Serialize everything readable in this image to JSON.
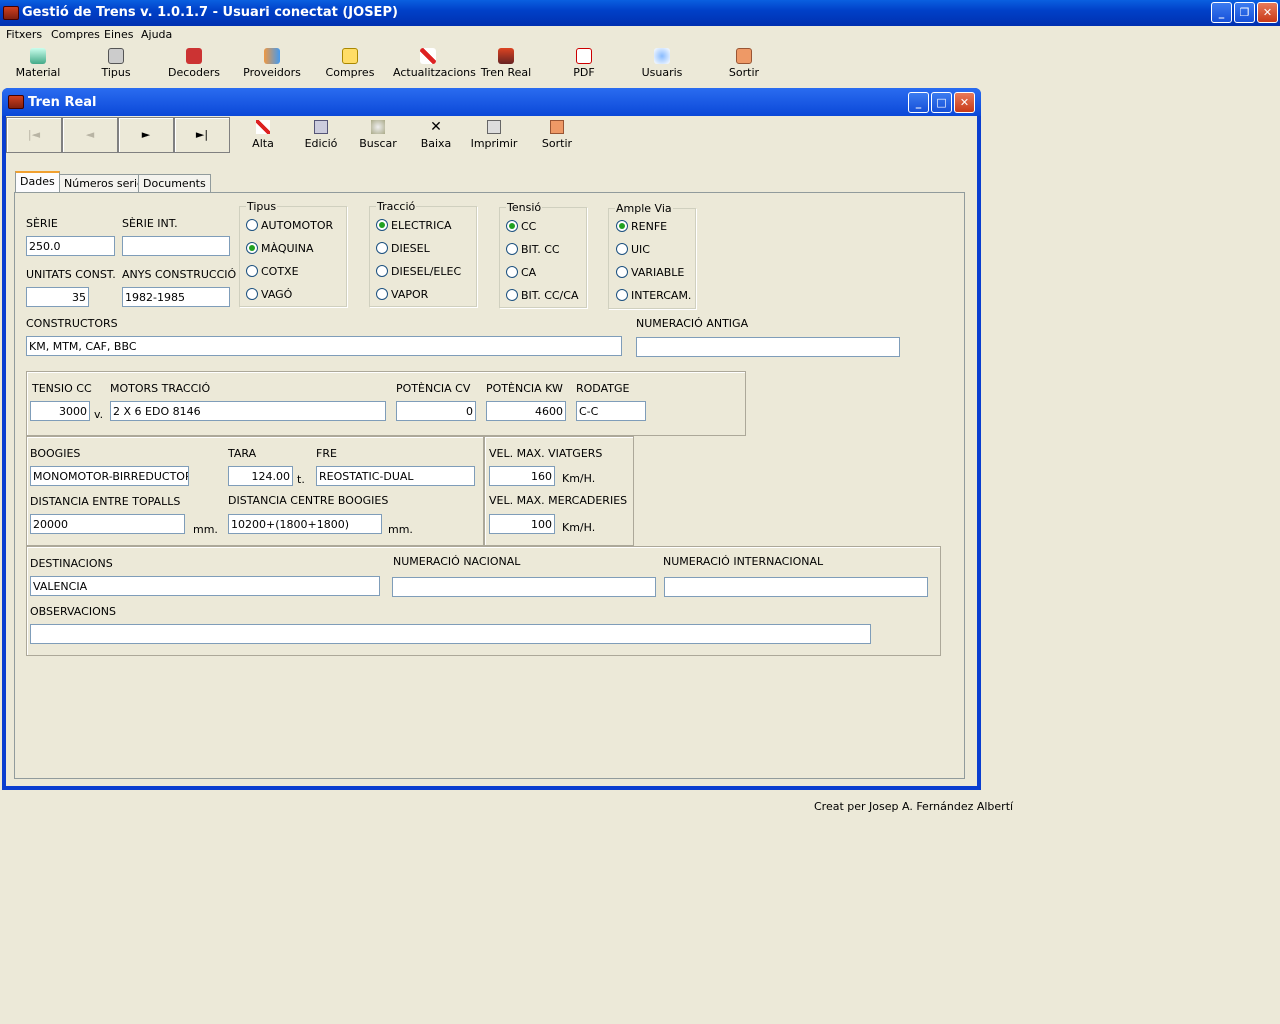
{
  "window": {
    "title": "Gestió de Trens v. 1.0.1.7 - Usuari conectat (JOSEP)"
  },
  "menu": [
    "Fitxers",
    "Compres",
    "Eines",
    "Ajuda"
  ],
  "toolbar": [
    {
      "label": "Material",
      "icon": "material-icon"
    },
    {
      "label": "Tipus",
      "icon": "train-icon"
    },
    {
      "label": "Decoders",
      "icon": "decoder-icon"
    },
    {
      "label": "Proveidors",
      "icon": "people-icon"
    },
    {
      "label": "Compres",
      "icon": "documents-icon"
    },
    {
      "label": "Actualitzacions",
      "icon": "pencil-icon"
    },
    {
      "label": "Tren Real",
      "icon": "locomotive-icon"
    },
    {
      "label": "PDF",
      "icon": "pdf-icon"
    },
    {
      "label": "Usuaris",
      "icon": "users-icon"
    },
    {
      "label": "Sortir",
      "icon": "exit-icon"
    }
  ],
  "child": {
    "title": "Tren Real",
    "nav": [
      "|◄",
      "◄",
      "►",
      "►|"
    ],
    "actions": [
      {
        "label": "Alta",
        "icon": "pencil-icon"
      },
      {
        "label": "Edició",
        "icon": "edit-icon"
      },
      {
        "label": "Buscar",
        "icon": "search-icon"
      },
      {
        "label": "Baixa",
        "icon": "delete-icon"
      },
      {
        "label": "Imprimir",
        "icon": "printer-icon"
      },
      {
        "label": "Sortir",
        "icon": "exit-icon"
      }
    ],
    "tabs": [
      "Dades",
      "Números serie",
      "Documents"
    ]
  },
  "form": {
    "serie_label": "SÈRIE",
    "serie": "250.0",
    "serie_int_label": "SÈRIE INT.",
    "serie_int": "",
    "unitats_label": "UNITATS CONST.",
    "unitats": "35",
    "anys_label": "ANYS CONSTRUCCIÓ",
    "anys": "1982-1985",
    "tipus": {
      "title": "Tipus",
      "options": [
        "AUTOMOTOR",
        "MÀQUINA",
        "COTXE",
        "VAGÓ"
      ],
      "selected": 1
    },
    "traccio": {
      "title": "Tracció",
      "options": [
        "ELECTRICA",
        "DIESEL",
        "DIESEL/ELEC",
        "VAPOR"
      ],
      "selected": 0
    },
    "tensio": {
      "title": "Tensió",
      "options": [
        "CC",
        "BIT. CC",
        "CA",
        "BIT. CC/CA"
      ],
      "selected": 0
    },
    "ample": {
      "title": "Ample Via",
      "options": [
        "RENFE",
        "UIC",
        "VARIABLE",
        "INTERCAM."
      ],
      "selected": 0
    },
    "constructors_label": "CONSTRUCTORS",
    "constructors": "KM, MTM, CAF, BBC",
    "num_antiga_label": "NUMERACIÓ ANTIGA",
    "num_antiga": "",
    "tensio_cc_label": "TENSIO CC",
    "tensio_cc": "3000",
    "tensio_unit": "v.",
    "motors_label": "MOTORS TRACCIÓ",
    "motors": "2 X 6 EDO 8146",
    "potencia_cv_label": "POTÈNCIA CV",
    "potencia_cv": "0",
    "potencia_kw_label": "POTÈNCIA KW",
    "potencia_kw": "4600",
    "rodatge_label": "RODATGE",
    "rodatge": "C-C",
    "boogies_label": "BOOGIES",
    "boogies": "MONOMOTOR-BIRREDUCTOR",
    "tara_label": "TARA",
    "tara": "124.00",
    "tara_unit": "t.",
    "fre_label": "FRE",
    "fre": "REOSTATIC-DUAL",
    "vel_viatgers_label": "VEL. MAX. VIATGERS",
    "vel_viatgers": "160",
    "vel_unit": "Km/H.",
    "vel_merc_label": "VEL. MAX. MERCADERIES",
    "vel_merc": "100",
    "topalls_label": "DISTANCIA ENTRE TOPALLS",
    "topalls": "20000",
    "mm_unit": "mm.",
    "centre_label": "DISTANCIA CENTRE BOOGIES",
    "centre": "10200+(1800+1800)",
    "destinacions_label": "DESTINACIONS",
    "destinacions": "VALENCIA",
    "num_nacional_label": "NUMERACIÓ NACIONAL",
    "num_nacional": "",
    "num_internacional_label": "NUMERACIÓ INTERNACIONAL",
    "num_internacional": "",
    "observacions_label": "OBSERVACIONS",
    "observacions": ""
  },
  "credit": "Creat per Josep A. Fernández Albertí"
}
